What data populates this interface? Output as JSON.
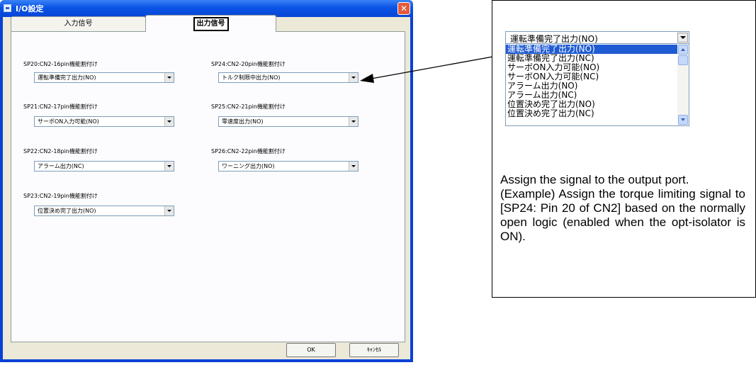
{
  "window": {
    "title": "I/O設定",
    "close_symbol": "✕"
  },
  "tabs": [
    {
      "label": "入力信号",
      "active": false
    },
    {
      "label": "出力信号",
      "active": true
    }
  ],
  "fields": [
    {
      "label": "SP20:CN2-16pin機能割付け",
      "value": "運転準備完了出力(NO)"
    },
    {
      "label": "SP21:CN2-17pin機能割付け",
      "value": "サーボON入力可能(NO)"
    },
    {
      "label": "SP22:CN2-18pin機能割付け",
      "value": "アラーム出力(NC)"
    },
    {
      "label": "SP23:CN2-19pin機能割付け",
      "value": "位置決め完了出力(NO)"
    },
    {
      "label": "SP24:CN2-20pin機能割付け",
      "value": "トルク制限中出力(NO)"
    },
    {
      "label": "SP25:CN2-21pin機能割付け",
      "value": "零速度出力(NO)"
    },
    {
      "label": "SP26:CN2-22pin機能割付け",
      "value": "ワーニング出力(NO)"
    }
  ],
  "buttons": {
    "ok": "OK",
    "cancel": "ｷｬﾝｾﾙ"
  },
  "callout": {
    "combo_value": "運転準備完了出力(NO)",
    "options": [
      "運転準備完了出力(NO)",
      "運転準備完了出力(NC)",
      "サーボON入力可能(NO)",
      "サーボON入力可能(NC)",
      "アラーム出力(NO)",
      "アラーム出力(NC)",
      "位置決め完了出力(NO)",
      "位置決め完了出力(NC)"
    ],
    "selected_index": 0,
    "description_line1": "Assign the signal to the output port.",
    "description_line2": "(Example) Assign the torque limiting signal to [SP24: Pin 20 of CN2] based on the normally open logic (enabled when the opt-isolator is ON)."
  },
  "colors": {
    "title_bar": "#0a54e6",
    "selection": "#1f5bd3",
    "dialog_bg": "#ece9d8",
    "close_button": "#e25c3c"
  }
}
